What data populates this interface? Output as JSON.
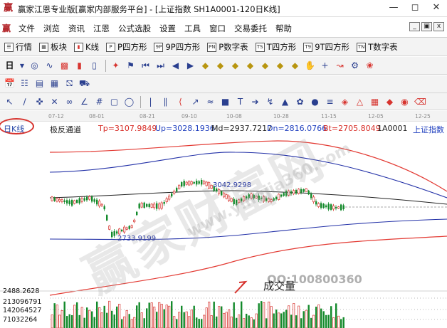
{
  "window": {
    "title": "赢家江恩专业版[赢家内部服务平台] - [上证指数  SH1A0001-120日K线]",
    "app_icon": "赢",
    "controls": [
      "minimize-icon",
      "maximize-icon",
      "close-icon"
    ]
  },
  "menu": {
    "logo": "赢",
    "items": [
      "文件",
      "浏览",
      "资讯",
      "江恩",
      "公式选股",
      "设置",
      "工具",
      "窗口",
      "交易委托",
      "帮助"
    ]
  },
  "toolbar1": {
    "items": [
      {
        "icon": "list-icon",
        "label": "行情"
      },
      {
        "icon": "sector-icon",
        "label": "板块"
      },
      {
        "icon": "kline-icon",
        "label": "K线"
      },
      {
        "icon": "p-square-icon",
        "label": "P四方形"
      },
      {
        "icon": "9p-square-icon",
        "label": "9P四方形"
      },
      {
        "icon": "p-number-icon",
        "label": "P数字表"
      },
      {
        "icon": "t-square-icon",
        "label": "T四方形"
      },
      {
        "icon": "9t-square-icon",
        "label": "9T四方形"
      },
      {
        "icon": "t-number-icon",
        "label": "T数字表"
      }
    ]
  },
  "dates": [
    "07-12",
    "08-01",
    "08-21",
    "09-10",
    "10-08",
    "10-28",
    "11-15",
    "12-05",
    "12-25"
  ],
  "period": {
    "label": "日K线"
  },
  "indicator": {
    "name": "极反通道",
    "tp": "Tp=3107.9849",
    "up": "Up=3028.1936",
    "md": "Md=2937.7217",
    "dn": "Dn=2816.0766",
    "bt": "Bt=2705.8049",
    "code": "1A0001",
    "index_name": "上证指数"
  },
  "annotations": {
    "high": "3042.9298",
    "low": "2733.9199"
  },
  "volume": {
    "title": "成交量",
    "axis_labels": [
      "2488.2628",
      "213096791",
      "142064527",
      "71032264"
    ]
  },
  "watermark": {
    "text": "赢家财富网",
    "url": "www.yingjia360.com",
    "qq": "QQ:100800360"
  },
  "colors": {
    "up": "#d7342f",
    "down": "#138a2b",
    "channel_outer": "#e33b34",
    "channel_inner": "#2432a8",
    "mid": "#222222"
  }
}
